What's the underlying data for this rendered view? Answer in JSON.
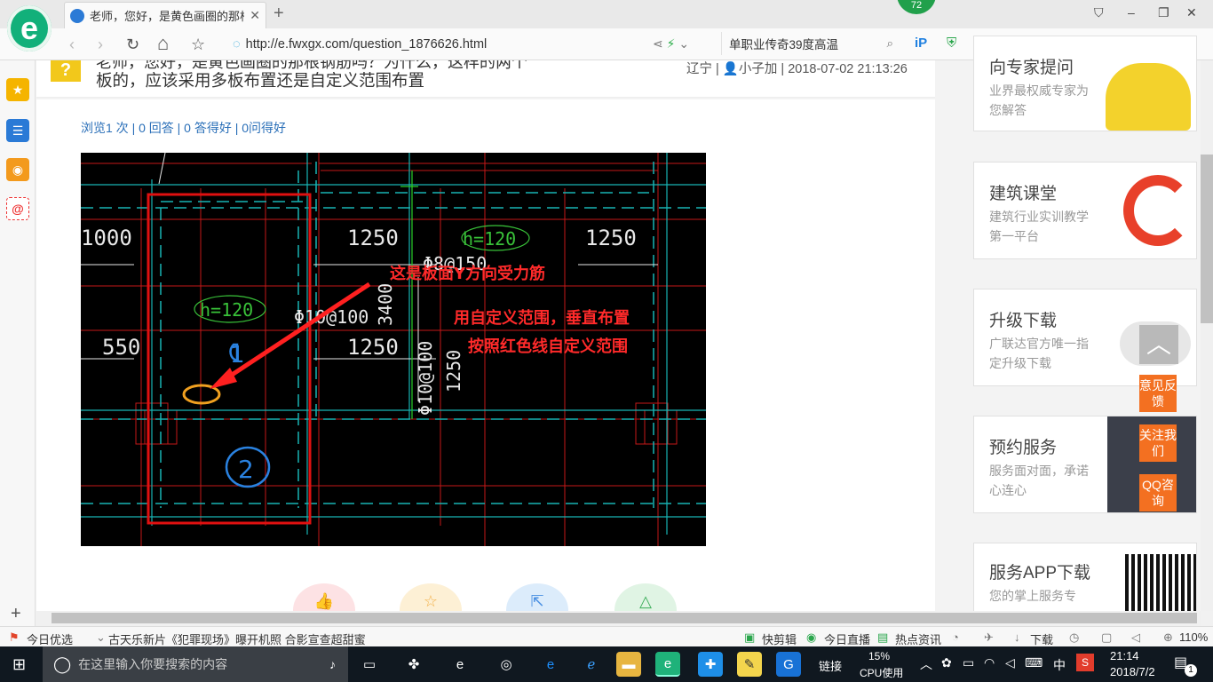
{
  "tab": {
    "title": "老师，您好，是黄色画圈的那根是",
    "close": "✕",
    "new_tab": "+"
  },
  "badge": "72",
  "window_controls": {
    "skin": "⛉",
    "minimize": "–",
    "restore": "❐",
    "close": "✕"
  },
  "nav": {
    "back": "‹",
    "forward": "›",
    "refresh": "↻",
    "home": "⌂",
    "star": "☆"
  },
  "address": {
    "url": "http://e.fwxgx.com/question_1876626.html"
  },
  "search": {
    "value": "单职业传奇39度高温"
  },
  "question": {
    "icon": "?",
    "title_line1": "老师，您好，是黄色画圈的那根钢筋吗？为什么，这样的两个",
    "title_line2": "板的，应该采用多板布置还是自定义范围布置",
    "meta": "辽宁 | 👤小子加 | 2018-07-02 21:13:26",
    "stats": "浏览1 次 | 0 回答 | 0 答得好 | 0问得好"
  },
  "cad": {
    "annotation1": "这是板面Y方向受力筋",
    "annotation2": "用自定义范围，垂直布置",
    "annotation3": "按照红色线自定义范围",
    "labels": [
      "1000",
      "1250",
      "1250",
      "550",
      "1250",
      "h=120",
      "h=120",
      "Φ8@150",
      "Φ10@100",
      "3400",
      "Φ10@100",
      "1250",
      "1",
      "2"
    ]
  },
  "sidebar_right": {
    "cards": [
      {
        "title": "向专家提问",
        "desc": "业界最权威专家为您解答"
      },
      {
        "title": "建筑课堂",
        "desc": "建筑行业实训教学第一平台"
      },
      {
        "title": "升级下载",
        "desc": "广联达官方唯一指定升级下载"
      },
      {
        "title": "预约服务",
        "desc": "服务面对面，承诺心连心"
      },
      {
        "title": "服务APP下载",
        "desc": "您的掌上服务专"
      }
    ],
    "feedback": [
      "意见反馈",
      "关注我们",
      "QQ咨询"
    ],
    "to_top": "︿"
  },
  "status_bar": {
    "today": "今日优选",
    "news": "古天乐新片《犯罪现场》曝开机照 合影宣查超甜蜜",
    "kuaijian": "快剪辑",
    "live": "今日直播",
    "hot": "热点资讯",
    "download": "下载",
    "zoom": "110%"
  },
  "taskbar": {
    "search_placeholder": "在这里输入你要搜索的内容",
    "link": "链接",
    "cpu_pct": "15%",
    "cpu_label": "CPU使用",
    "ime": "中",
    "time": "21:14",
    "date": "2018/7/2",
    "notif": "1"
  }
}
